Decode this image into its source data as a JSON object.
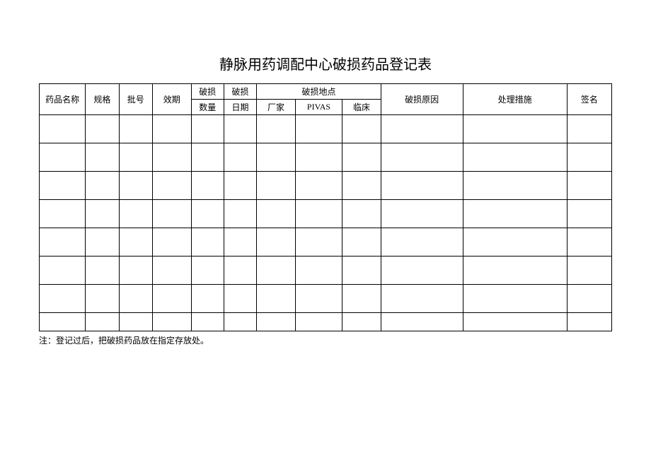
{
  "title": "静脉用药调配中心破损药品登记表",
  "headers": {
    "drug_name": "药品名称",
    "spec": "规格",
    "batch": "批号",
    "expiry": "效期",
    "damage_qty_line1": "破损",
    "damage_qty_line2": "数量",
    "damage_date_line1": "破损",
    "damage_date_line2": "日期",
    "location": "破损地点",
    "loc_factory": "厂家",
    "loc_pivas": "PIVAS",
    "loc_clinical": "临床",
    "reason": "破损原因",
    "action": "处理措施",
    "signature": "签名"
  },
  "footnote": "注：登记过后，把破损药品放在指定存放处。"
}
